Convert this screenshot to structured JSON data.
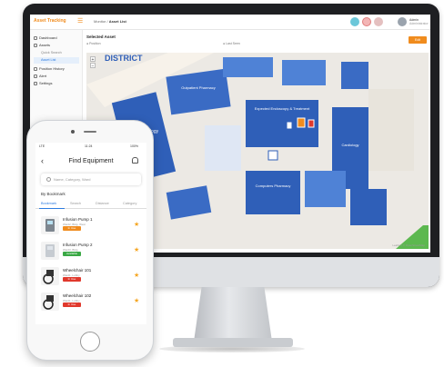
{
  "desktop": {
    "logo": "Asset Tracking",
    "breadcrumb_parent": "Monitor",
    "breadcrumb_current": "Asset List",
    "user_name": "Admin",
    "user_role": "Administrator",
    "sidebar": {
      "items": [
        {
          "label": "Dashboard"
        },
        {
          "label": "Assets"
        },
        {
          "label": "Position History"
        },
        {
          "label": "Alert"
        },
        {
          "label": "Settings"
        }
      ],
      "subitems": [
        {
          "label": "Quick Search"
        },
        {
          "label": "Asset List"
        }
      ]
    },
    "content_title": "Selected Asset",
    "filter_position": "Position",
    "filter_last_seen": "Last Seen",
    "action_button": "Edit",
    "map": {
      "labels": [
        {
          "text": "Radiology"
        },
        {
          "text": "Outpatient Pharmacy"
        },
        {
          "text": "Expected Endoscopy & Treatment"
        },
        {
          "text": "Cardiology"
        },
        {
          "text": "Computers Pharmacy"
        }
      ],
      "street_text": "DISTRICT",
      "zoom_in": "+",
      "zoom_out": "−",
      "footer": "Leaflet | © OpenStreetMap"
    },
    "colors": {
      "accent": "#f08c1e",
      "building": "#2f5fb8",
      "building_light": "#4f82d6",
      "primary": "#2d7be0"
    }
  },
  "mobile": {
    "status_time": "11:24",
    "status_carrier": "LTE",
    "status_battery": "100%",
    "back_icon": "chevron-left-icon",
    "title": "Find Equipment",
    "search_placeholder": "Name, Category, Ward",
    "section_label": "By Bookmark",
    "tabs": [
      {
        "label": "Bookmark"
      },
      {
        "label": "Search"
      },
      {
        "label": "Distance"
      },
      {
        "label": "Category"
      }
    ],
    "items": [
      {
        "name": "Infusion Pump 1",
        "sub": "Ward2, Bldg. West",
        "status": "In Use",
        "status_color": "#f08c1e",
        "icon": "infusion-pump-icon"
      },
      {
        "name": "Infusion Pump 2",
        "sub": "Ward3, Bldg.",
        "status": "Available",
        "status_color": "#3aa845",
        "icon": "infusion-pump-icon"
      },
      {
        "name": "Wheelchair 101",
        "sub": "Ward1, Lobby",
        "status": "In Use",
        "status_color": "#e0392d",
        "icon": "wheelchair-icon"
      },
      {
        "name": "Wheelchair 102",
        "sub": "Ward1, Lobby",
        "status": "In Use",
        "status_color": "#e0392d",
        "icon": "wheelchair-icon"
      }
    ]
  }
}
